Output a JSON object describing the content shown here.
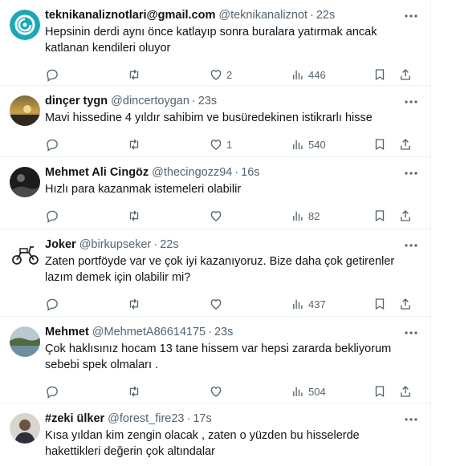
{
  "tweets": [
    {
      "name": "teknikanaliznotlari@gmail.com",
      "handle": "@teknikanaliznot",
      "time": "22s",
      "text": "Hepsinin derdi aynı önce katlayıp sonra buralara yatırmak ancak katlanan kendileri oluyor",
      "likes": "2",
      "views": "446",
      "avatar": "teal-logo"
    },
    {
      "name": "dinçer tygn",
      "handle": "@dincertoygan",
      "time": "23s",
      "text": "Mavi hissedine 4 yıldır sahibim ve busüredekinen istikrarlı hisse",
      "likes": "1",
      "views": "540",
      "avatar": "sunset-photo"
    },
    {
      "name": "Mehmet Ali Cingöz",
      "handle": "@thecingozz94",
      "time": "16s",
      "text": "Hızlı para kazanmak istemeleri olabilir",
      "likes": "",
      "views": "82",
      "avatar": "dark-photo"
    },
    {
      "name": "Joker",
      "handle": "@birkupseker",
      "time": "22s",
      "text": "Zaten portföyde var ve çok iyi kazanıyoruz. Bize daha çok getirenler lazım demek için olabilir mi?",
      "likes": "",
      "views": "437",
      "avatar": "scooter-drawing"
    },
    {
      "name": "Mehmet",
      "handle": "@MehmetA86614175",
      "time": "23s",
      "text": "Çok haklısınız hocam 13 tane hissem var hepsi zararda bekliyorum sebebi spek olmaları .",
      "likes": "",
      "views": "504",
      "avatar": "lake-photo"
    },
    {
      "name": "#zeki ülker",
      "handle": "@forest_fire23",
      "time": "17s",
      "text": "Kısa yıldan kim zengin olacak , zaten o yüzden bu hisselerde hakettikleri değerin çok altındalar",
      "likes": "",
      "views": "",
      "avatar": "person-photo"
    }
  ],
  "separator": "·",
  "colors": {
    "text": "#0f1419",
    "muted": "#536471",
    "border": "#eff3f4",
    "teal": "#1aa7b7"
  }
}
